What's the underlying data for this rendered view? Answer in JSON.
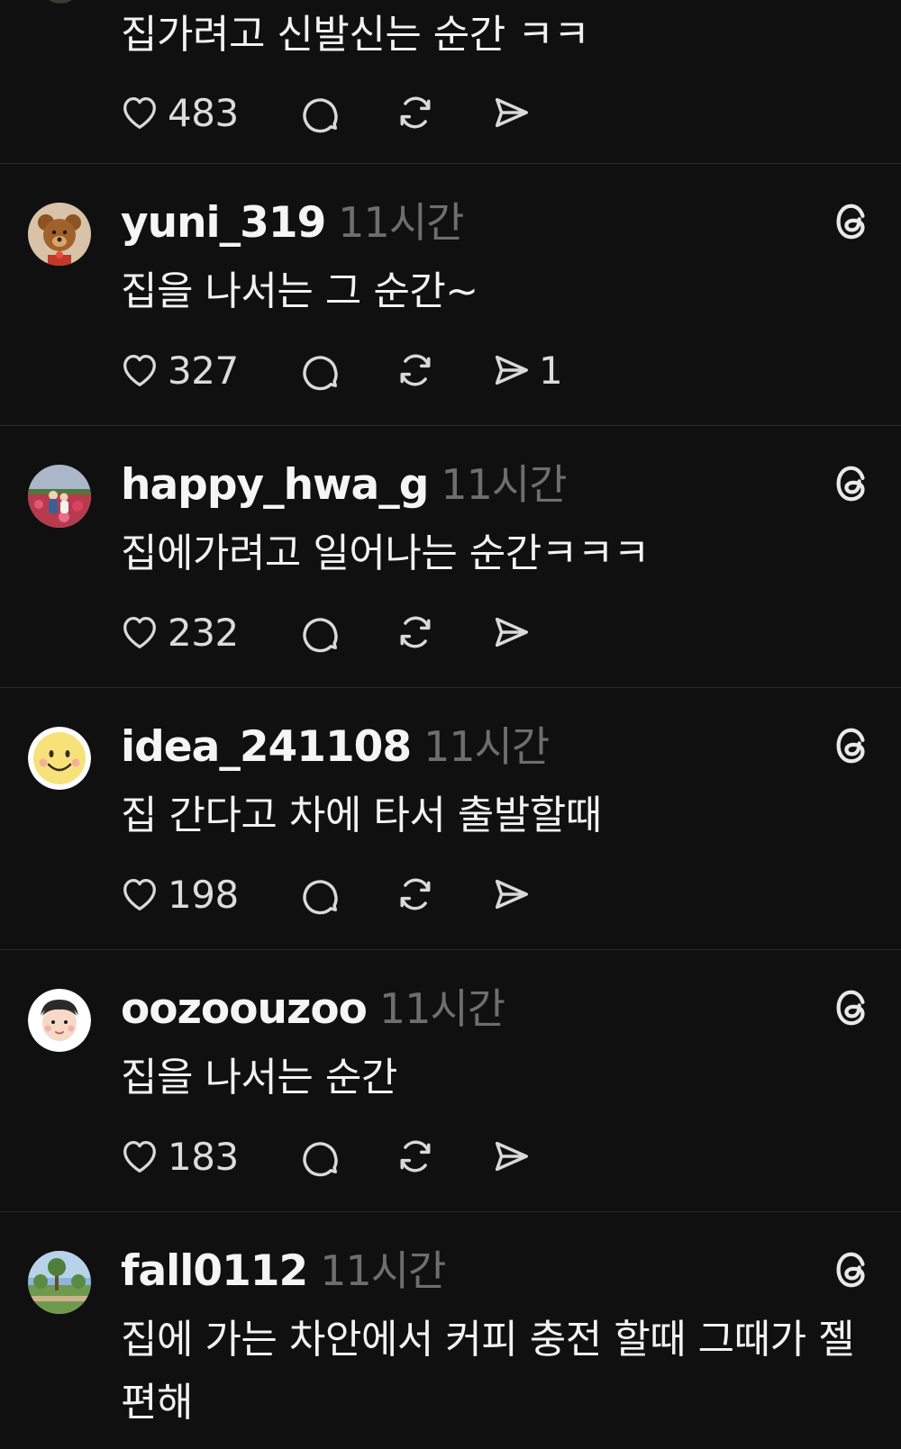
{
  "posts": [
    {
      "username": "",
      "time": "",
      "text": "집가려고 신발신는 순간 ㅋㅋ",
      "likes": "483",
      "shares": "",
      "avatar": "",
      "partial_top": true
    },
    {
      "username": "yuni_319",
      "time": "11시간",
      "text": "집을 나서는 그 순간~",
      "likes": "327",
      "shares": "1",
      "avatar": "teddy-bear"
    },
    {
      "username": "happy_hwa_g",
      "time": "11시간",
      "text": "집에가려고 일어나는 순간ㅋㅋㅋ",
      "likes": "232",
      "shares": "",
      "avatar": "flower-field-photo"
    },
    {
      "username": "idea_241108",
      "time": "11시간",
      "text": "집 간다고 차에 타서 출발할때",
      "likes": "198",
      "shares": "",
      "avatar": "smiley-face"
    },
    {
      "username": "oozoouzoo",
      "time": "11시간",
      "text": "집을 나서는 순간",
      "likes": "183",
      "shares": "",
      "avatar": "cartoon-face"
    },
    {
      "username": "fall0112",
      "time": "11시간",
      "text": "집에 가는 차안에서 커피 충전 할때 그때가 젤 편해",
      "likes": "",
      "shares": "",
      "avatar": "park-landscape-photo"
    }
  ],
  "icons": {
    "like": "heart-outline-icon",
    "reply": "speech-bubble-icon",
    "repost": "repost-arrows-icon",
    "share": "send-icon",
    "brand": "threads-logo-icon"
  },
  "colors": {
    "background": "#101010",
    "text": "#f3f3f3",
    "muted": "#6e6e6e",
    "divider": "#2a2a2a"
  }
}
